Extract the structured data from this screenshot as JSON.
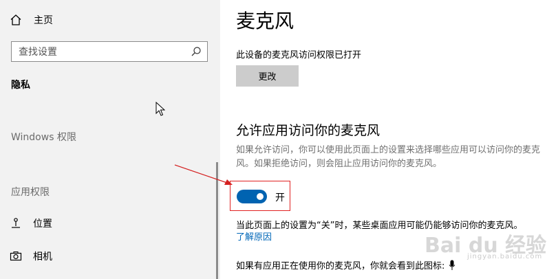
{
  "sidebar": {
    "home": {
      "label": "主页",
      "icon": "home-icon"
    },
    "search": {
      "placeholder": "查找设置",
      "icon": "search-icon"
    },
    "current_section": "隐私",
    "groups": {
      "windows": "Windows 权限",
      "app": "应用权限"
    },
    "items": [
      {
        "label": "位置",
        "icon": "location-icon"
      },
      {
        "label": "相机",
        "icon": "camera-icon"
      }
    ]
  },
  "main": {
    "title": "麦克风",
    "device_status": "此设备的麦克风访问权限已打开",
    "change_button": "更改",
    "section_heading": "允许应用访问你的麦克风",
    "description": "如果允许访问，你可以使用此页面上的设置来选择哪些应用可以访问你的麦克风。如果拒绝访问，则会阻止应用访问你的麦克风。",
    "toggle": {
      "state": "开",
      "on": true
    },
    "note": "当此页面上的设置为“关”时，某些桌面应用可能仍能够访问你的麦克风。",
    "learn_more": "了解原因",
    "in_use_text": "如果有应用正在使用你的麦克风，你就会看到此图标:"
  },
  "watermark": {
    "brand": "Bai du 经验",
    "sub": "jingyan.baidu.com"
  },
  "colors": {
    "accent": "#0063b1",
    "link": "#0067b8",
    "highlight": "#e02020",
    "sidebar_bg": "#f2f2f2"
  }
}
